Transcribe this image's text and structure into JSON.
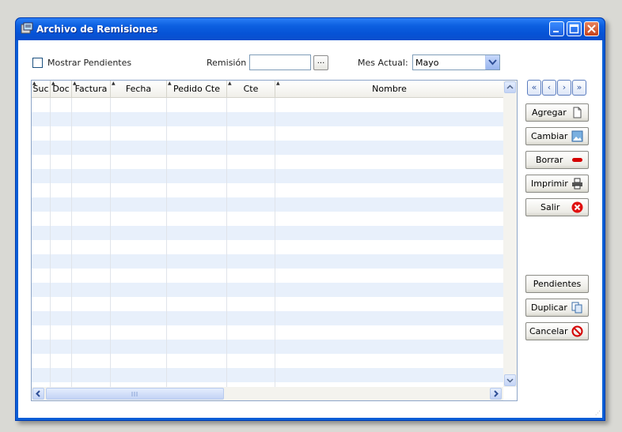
{
  "window": {
    "title": "Archivo de Remisiones"
  },
  "filters": {
    "show_pending_label": "Mostrar Pendientes",
    "remision_label": "Remisión",
    "remision_value": "",
    "browse_label": "...",
    "month_label": "Mes Actual:",
    "month_value": "Mayo"
  },
  "grid": {
    "columns": [
      "Suc",
      "Doc",
      "Factura",
      "Fecha",
      "Pedido Cte",
      "Cte",
      "Nombre"
    ],
    "rows": []
  },
  "nav": {
    "first": "«",
    "prev": "‹",
    "next": "›",
    "last": "»"
  },
  "actions": {
    "agregar": "Agregar",
    "cambiar": "Cambiar",
    "borrar": "Borrar",
    "imprimir": "Imprimir",
    "salir": "Salir",
    "pendientes": "Pendientes",
    "duplicar": "Duplicar",
    "cancelar": "Cancelar"
  },
  "colors": {
    "titlebar": "#0a5ed6",
    "row_alt": "#e8f0fb",
    "close": "#c6411b"
  }
}
